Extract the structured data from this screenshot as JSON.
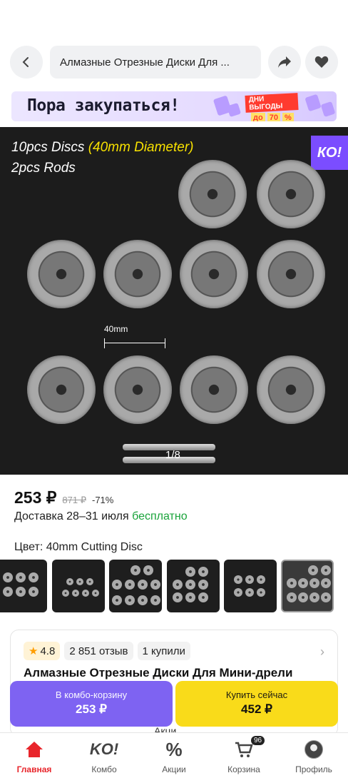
{
  "header": {
    "search_value": "Алмазные Отрезные Диски Для ...",
    "back_icon": "chevron-left-icon",
    "share_icon": "share-arrow-icon",
    "favorite_icon": "heart-icon"
  },
  "promo": {
    "text": "Пора закупаться!",
    "badge_line1": "ДНИ ВЫГОДЫ",
    "badge_do": "до",
    "badge_70": "70",
    "badge_pct": "%"
  },
  "gallery": {
    "line1_prefix": "10pcs Discs ",
    "line1_highlight": "(40mm Diameter)",
    "line2": "2pcs Rods",
    "dimension": "40mm",
    "ko_badge": "КО!",
    "page_indicator": "1/8"
  },
  "price": {
    "current": "253 ₽",
    "old": "871 ₽",
    "discount": "-71%"
  },
  "delivery": {
    "text": "Доставка 28–31 июля ",
    "free": "бесплатно"
  },
  "variant": {
    "label": "Цвет: 40mm Cutting Disc"
  },
  "card": {
    "rating": "4.8",
    "reviews": "2 851 отзыв",
    "bought": "1 купили",
    "title": "Алмазные Отрезные Диски Для Мини-дрели"
  },
  "actions": {
    "combo_label": "В комбо-корзину",
    "combo_price": "253 ₽",
    "buy_label": "Купить сейчас",
    "buy_price": "452 ₽",
    "partial_text": "Акци"
  },
  "tabbar": {
    "items": [
      {
        "label": "Главная",
        "icon": "home-icon"
      },
      {
        "label": "Комбо",
        "icon": "ko-logo-icon"
      },
      {
        "label": "Акции",
        "icon": "percent-icon"
      },
      {
        "label": "Корзина",
        "icon": "cart-icon",
        "badge": "96"
      },
      {
        "label": "Профиль",
        "icon": "avatar-icon"
      }
    ]
  },
  "colors": {
    "accent_red": "#e8252b",
    "combo_purple": "#7e63f2",
    "buy_yellow": "#f9db1a",
    "free_green": "#19a33a"
  }
}
